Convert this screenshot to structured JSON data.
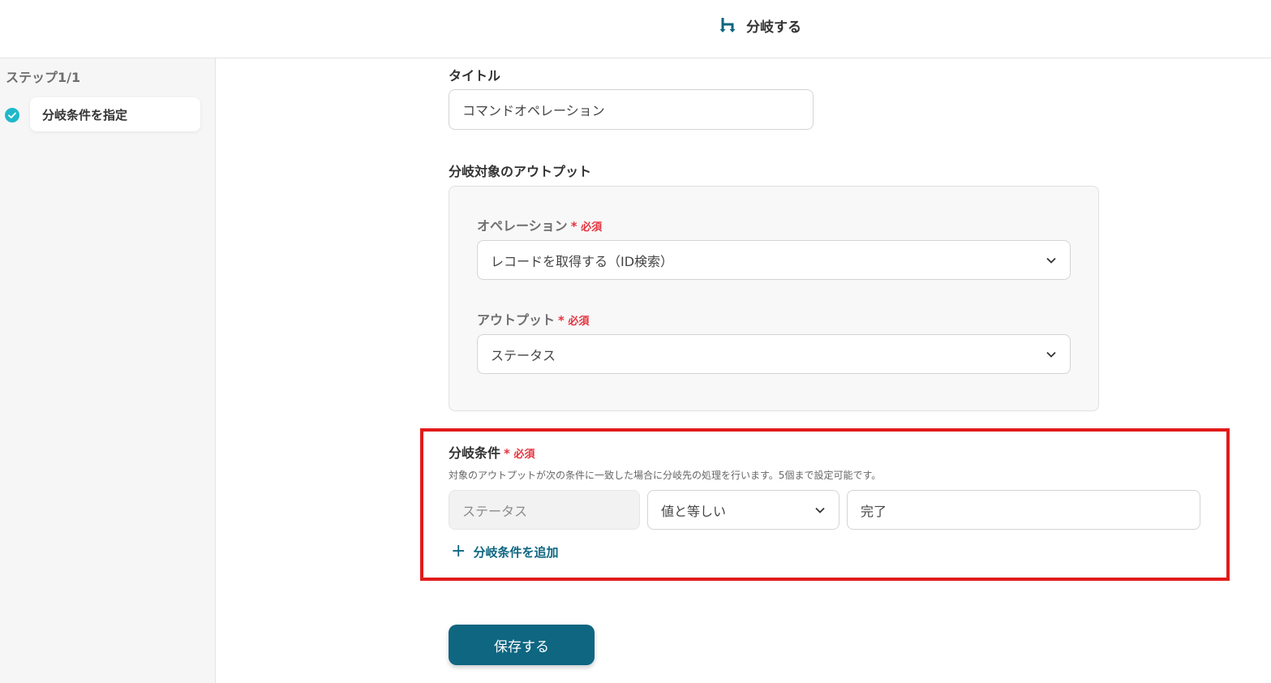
{
  "header": {
    "title": "分岐する",
    "icon": "branch-icon"
  },
  "sidebar": {
    "step_count": "ステップ1/1",
    "steps": [
      {
        "label": "分岐条件を指定",
        "status": "complete"
      }
    ]
  },
  "form": {
    "title_label": "タイトル",
    "title_value": "コマンドオペレーション",
    "output_section_label": "分岐対象のアウトプット",
    "operation": {
      "label": "オペレーション",
      "required": "必須",
      "value": "レコードを取得する（ID検索）"
    },
    "output": {
      "label": "アウトプット",
      "required": "必須",
      "value": "ステータス"
    },
    "condition": {
      "label": "分岐条件",
      "required": "必須",
      "description": "対象のアウトプットが次の条件に一致した場合に分岐先の処理を行います。5個まで設定可能です。",
      "field": "ステータス",
      "operator": "値と等しい",
      "value": "完了",
      "add_label": "分岐条件を追加"
    },
    "save_label": "保存する"
  },
  "colors": {
    "accent": "#0e6681",
    "required": "#e5343f",
    "highlight": "#e21b1b",
    "check": "#1fb8c9"
  }
}
